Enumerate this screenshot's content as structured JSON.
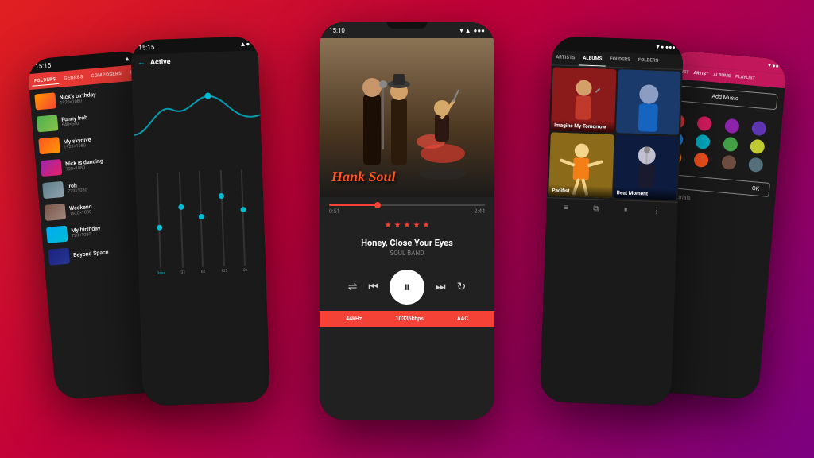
{
  "background": {
    "gradient_start": "#e02020",
    "gradient_end": "#7b0080"
  },
  "phone_left": {
    "status_time": "15:15",
    "tabs": [
      "FOLDERS",
      "GENRES",
      "COMPOSERS",
      "P"
    ],
    "files": [
      {
        "name": "Nick's birthday",
        "size": "1920×1080",
        "thumb_class": "thumb-birthday"
      },
      {
        "name": "Funny Iroh",
        "size": "640×640",
        "thumb_class": "thumb-funny"
      },
      {
        "name": "My skydive",
        "size": "1920×1080",
        "thumb_class": "thumb-skydive"
      },
      {
        "name": "Nick is dancing",
        "size": "720×1080",
        "thumb_class": "thumb-dancing"
      },
      {
        "name": "Iroh",
        "size": "720×1080",
        "thumb_class": "thumb-iroh"
      },
      {
        "name": "Weekend",
        "size": "1920×1080",
        "thumb_class": "thumb-weekend"
      },
      {
        "name": "My birthday",
        "size": "720×1080",
        "thumb_class": "thumb-my-birthday"
      },
      {
        "name": "Beyond Space",
        "size": "",
        "thumb_class": "thumb-beyond"
      }
    ]
  },
  "phone_center_left": {
    "status_time": "15:15",
    "title": "Active",
    "sliders": [
      {
        "label": "Bass",
        "value": "31",
        "position": 40
      },
      {
        "label": "",
        "value": "62",
        "position": 60
      },
      {
        "label": "",
        "value": "125",
        "position": 50
      },
      {
        "label": "",
        "value": "2k",
        "position": 70
      }
    ]
  },
  "phone_center": {
    "status_time": "15:10",
    "album_art_text": "Hank Soul",
    "progress_current": "0:51",
    "progress_total": "2:44",
    "stars": 5,
    "track_title": "Honey, Close Your Eyes",
    "track_artist": "SOUL BAND",
    "audio_quality": "44kHz",
    "bitrate": "10335kbps",
    "format": "AAC"
  },
  "phone_center_right": {
    "tabs": [
      "ARTISTS",
      "ALBUMS",
      "FOLDERS",
      "FOLDERS"
    ],
    "albums": [
      {
        "name": "Imagine My Tomorrow",
        "bg_class": "imagine-bg"
      },
      {
        "name": "",
        "bg_class": "pacifist-bg"
      },
      {
        "name": "Pacifist",
        "bg_class": "pacifist-bg"
      },
      {
        "name": "Beat Moment",
        "bg_class": "beat-bg"
      }
    ]
  },
  "phone_right": {
    "tabs": [
      "ARTIST",
      "ARTIST",
      "ALBUMS",
      "PLAYLIST"
    ],
    "add_music_label": "Add Music",
    "colors": [
      "#e53935",
      "#d81b60",
      "#8e24aa",
      "#5e35b1",
      "#1e88e5",
      "#00acc1",
      "#43a047",
      "#c0ca33",
      "#fb8c00",
      "#f4511e",
      "#6d4c41",
      "#546e7a"
    ],
    "ok_label": "OK",
    "tutorials_label": "w Tutorials"
  },
  "icons": {
    "back_arrow": "←",
    "shuffle": "⇌",
    "previous": "⏮",
    "pause": "⏸",
    "next": "⏭",
    "repeat": "↻",
    "menu": "≡",
    "layers": "⧉",
    "pause_small": "⏸",
    "dots": "⋮"
  }
}
